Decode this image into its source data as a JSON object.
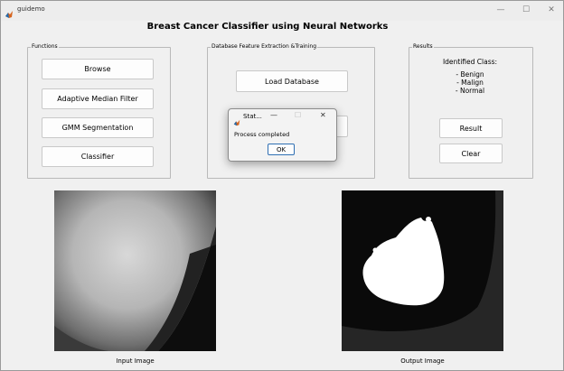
{
  "window": {
    "title": "guidemo",
    "minimize": "—",
    "maximize": "☐",
    "close": "✕"
  },
  "heading": "Breast Cancer Classifier using Neural Networks",
  "functions_panel": {
    "title": "Functions",
    "buttons": [
      "Browse",
      "Adaptive Median Filter",
      "GMM Segmentation",
      "Classifier"
    ]
  },
  "database_panel": {
    "title": "Database Feature Extraction &Training",
    "load_button": "Load Database"
  },
  "results_panel": {
    "title": "Results",
    "identified_label": "Identified Class:",
    "classes": [
      "- Benign",
      "- Malign",
      "- Normal"
    ],
    "result_button": "Result",
    "clear_button": "Clear"
  },
  "images": {
    "input_caption": "Input Image",
    "output_caption": "Output Image"
  },
  "dialog": {
    "title": "Stat...",
    "minimize": "—",
    "maximize": "☐",
    "close": "✕",
    "message": "Process completed",
    "ok_label": "OK"
  }
}
